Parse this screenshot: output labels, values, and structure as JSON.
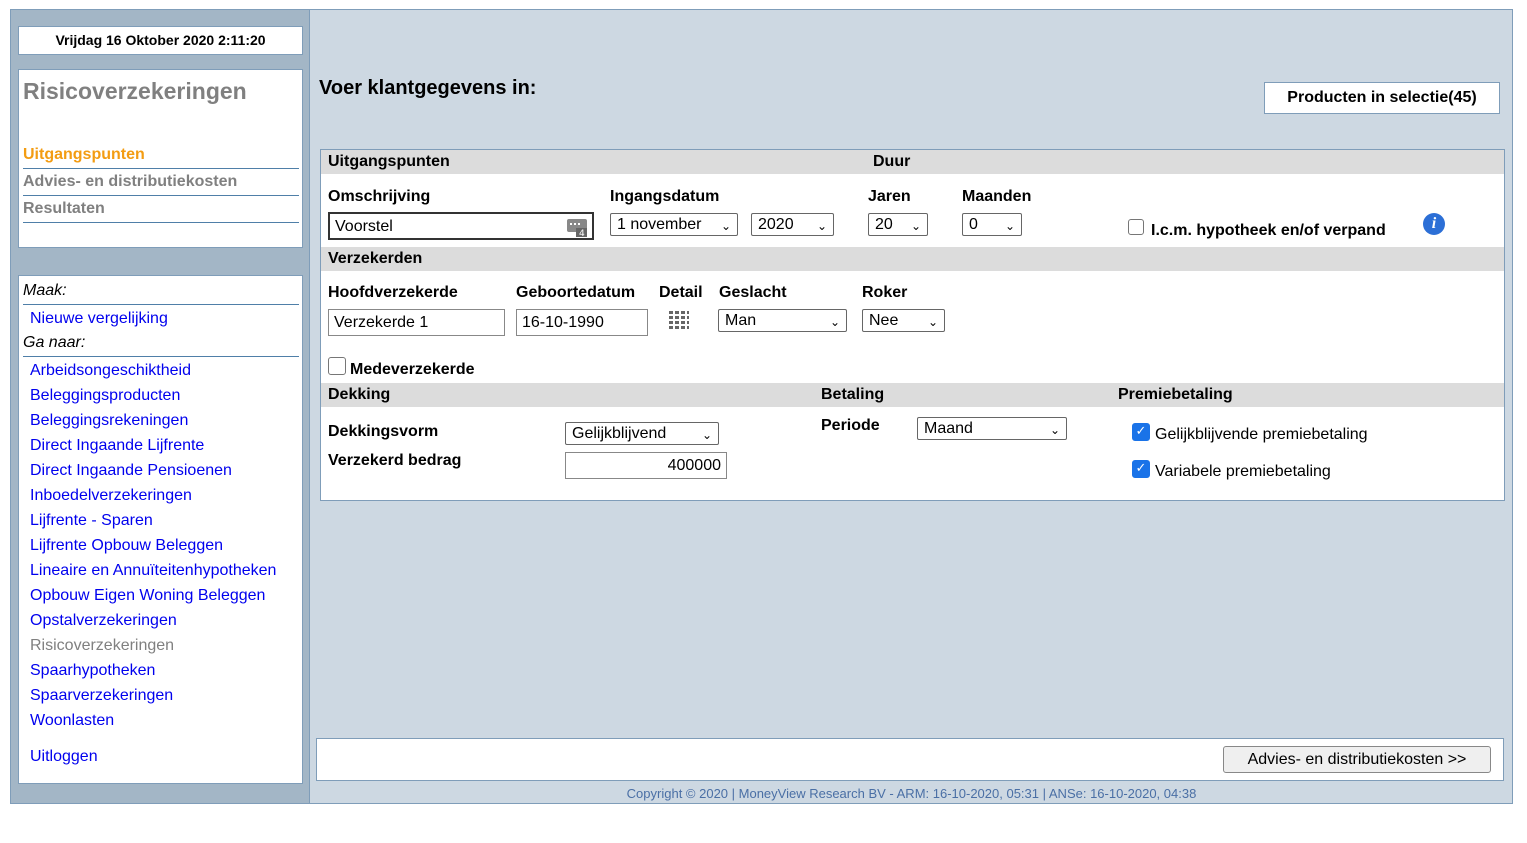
{
  "sidebar": {
    "datetime": "Vrijdag 16 Oktober 2020   2:11:20",
    "app_title": "Risicoverzekeringen",
    "steps": [
      "Uitgangspunten",
      "Advies- en distributiekosten",
      "Resultaten"
    ],
    "make_label": "Maak:",
    "new_comparison": "Nieuwe vergelijking",
    "goto_label": "Ga naar:",
    "nav": [
      "Arbeidsongeschiktheid",
      "Beleggingsproducten",
      "Beleggingsrekeningen",
      "Direct Ingaande Lijfrente",
      "Direct Ingaande Pensioenen",
      "Inboedelverzekeringen",
      "Lijfrente - Sparen",
      "Lijfrente Opbouw Beleggen",
      "Lineaire en Annuïteitenhypotheken",
      "Opbouw Eigen Woning Beleggen",
      "Opstalverzekeringen",
      "Risicoverzekeringen",
      "Spaarhypotheken",
      "Spaarverzekeringen",
      "Woonlasten"
    ],
    "logout": "Uitloggen"
  },
  "main": {
    "title": "Voer klantgegevens in:",
    "products_button": "Producten in selectie(45)",
    "section_uitgangspunten": "Uitgangspunten",
    "section_duur": "Duur",
    "omschrijving_label": "Omschrijving",
    "omschrijving_value": "Voorstel",
    "ingangsdatum_label": "Ingangsdatum",
    "ingangsdatum_month": "1 november",
    "ingangsdatum_year": "2020",
    "jaren_label": "Jaren",
    "jaren_value": "20",
    "maanden_label": "Maanden",
    "maanden_value": "0",
    "icm_label": "I.c.m. hypotheek en/of verpand",
    "section_verzekerden": "Verzekerden",
    "hoofd_label": "Hoofdverzekerde",
    "hoofd_value": "Verzekerde 1",
    "geboorte_label": "Geboortedatum",
    "geboorte_value": "16-10-1990",
    "detail_label": "Detail",
    "geslacht_label": "Geslacht",
    "geslacht_value": "Man",
    "roker_label": "Roker",
    "roker_value": "Nee",
    "medeverzekerde_label": "Medeverzekerde",
    "section_dekking": "Dekking",
    "section_betaling": "Betaling",
    "section_premiebetaling": "Premiebetaling",
    "dekkingsvorm_label": "Dekkingsvorm",
    "dekkingsvorm_value": "Gelijkblijvend",
    "bedrag_label": "Verzekerd bedrag",
    "bedrag_value": "400000",
    "periode_label": "Periode",
    "periode_value": "Maand",
    "premie_gelijk": "Gelijkblijvende premiebetaling",
    "premie_variabel": "Variabele premiebetaling",
    "next_button": "Advies- en distributiekosten >>",
    "copyright": "Copyright © 2020 | MoneyView Research BV - ARM: 16-10-2020, 05:31 | ANSe: 16-10-2020, 04:38"
  },
  "colors": {
    "active_step": "#f39c12",
    "link": "#0000ee",
    "sidebar_bg": "#a3b6c6",
    "main_bg": "#cdd8e2"
  }
}
